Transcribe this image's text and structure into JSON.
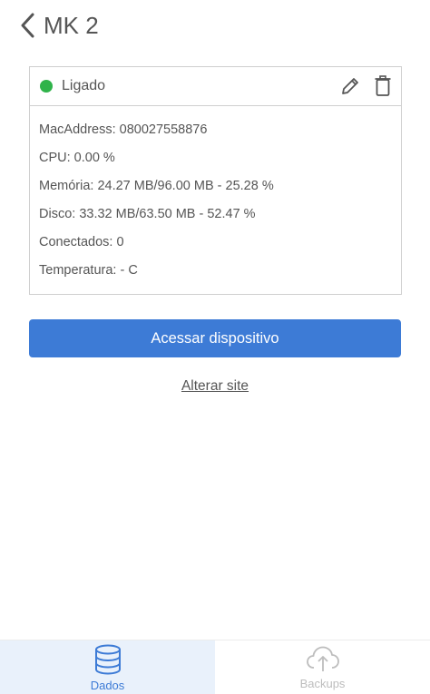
{
  "header": {
    "title": "MK 2"
  },
  "card": {
    "status_label": "Ligado",
    "status_color": "#2fb34a",
    "lines": [
      "MacAddress: 080027558876",
      "CPU: 0.00 %",
      "Memória: 24.27 MB/96.00 MB - 25.28 %",
      "Disco: 33.32 MB/63.50 MB - 52.47 %",
      "Conectados: 0",
      "Temperatura: - C"
    ]
  },
  "actions": {
    "primary_label": "Acessar dispositivo",
    "link_label": "Alterar site"
  },
  "bottom_nav": {
    "items": [
      {
        "label": "Dados",
        "icon": "database-icon",
        "active": true
      },
      {
        "label": "Backups",
        "icon": "cloud-upload-icon",
        "active": false
      }
    ]
  },
  "colors": {
    "accent": "#3d7bd6",
    "status_online": "#2fb34a",
    "active_tab_bg": "#e9f1fb"
  }
}
